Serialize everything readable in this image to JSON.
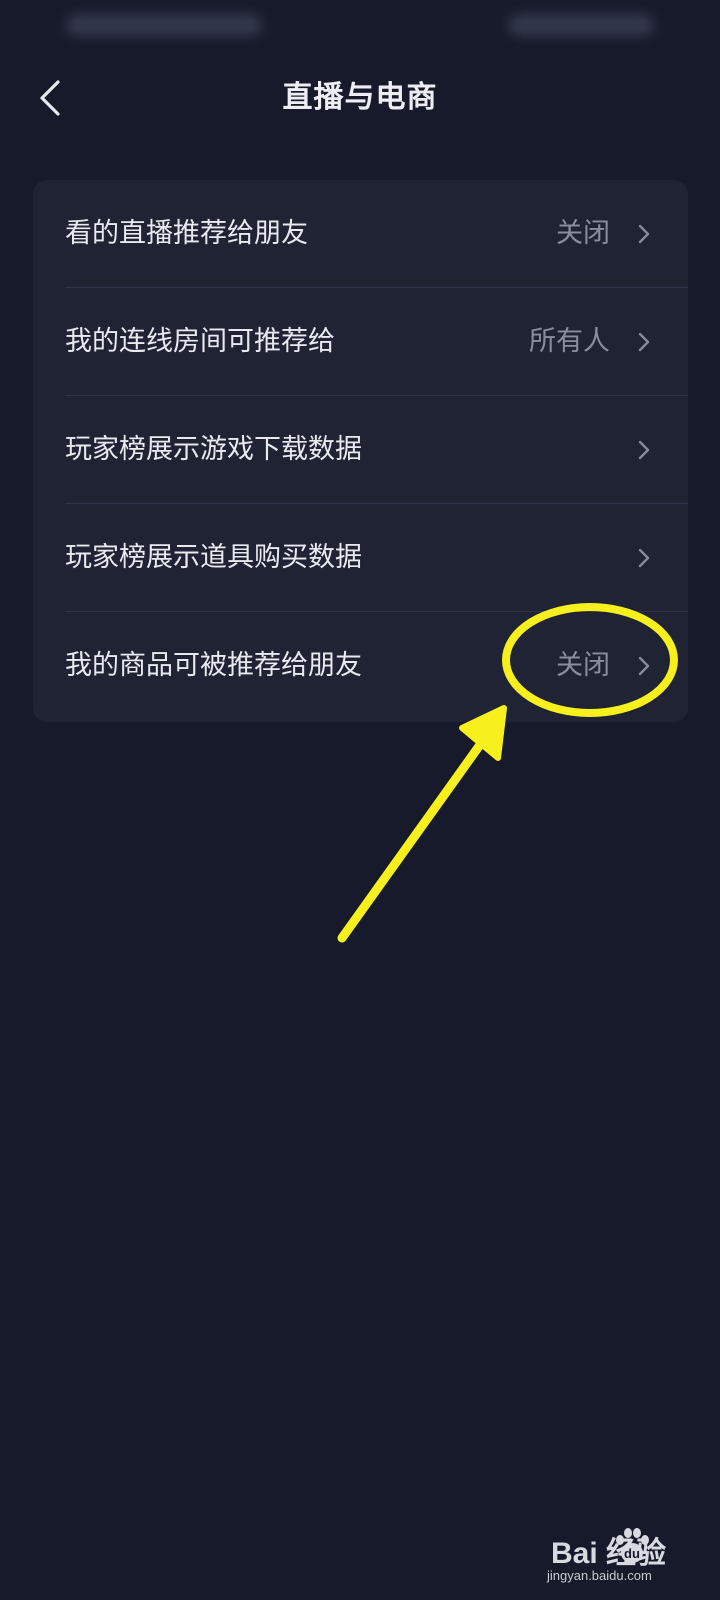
{
  "header": {
    "title": "直播与电商",
    "back_icon": "chevron-left-icon"
  },
  "settings": [
    {
      "label": "看的直播推荐给朋友",
      "value": "关闭"
    },
    {
      "label": "我的连线房间可推荐给",
      "value": "所有人"
    },
    {
      "label": "玩家榜展示游戏下载数据",
      "value": ""
    },
    {
      "label": "玩家榜展示道具购买数据",
      "value": ""
    },
    {
      "label": "我的商品可被推荐给朋友",
      "value": "关闭"
    }
  ],
  "annotation": {
    "color": "#f7f01c",
    "shape": "circle-and-arrow"
  },
  "watermark": {
    "brand": "Bai  经验",
    "url": "jingyan.baidu.com"
  },
  "colors": {
    "background": "#161a2a",
    "card": "#1f2334",
    "text_primary": "#e8eaf0",
    "text_secondary": "#8a8e9c"
  }
}
